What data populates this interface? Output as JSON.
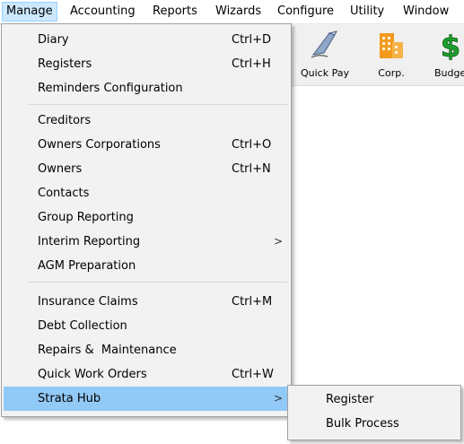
{
  "menubar": {
    "items": [
      {
        "label": "Manage"
      },
      {
        "label": "Accounting"
      },
      {
        "label": "Reports"
      },
      {
        "label": "Wizards"
      },
      {
        "label": "Configure"
      },
      {
        "label": "Utility"
      },
      {
        "label": "Window"
      }
    ]
  },
  "toolbar": {
    "buttons": [
      {
        "label": "Quick Pay",
        "icon": "quill-pen-icon"
      },
      {
        "label": "Corp.",
        "icon": "building-icon"
      },
      {
        "label": "Budge",
        "icon": "dollar-icon"
      }
    ]
  },
  "manage_menu": {
    "items": [
      {
        "label": "Diary",
        "shortcut": "Ctrl+D"
      },
      {
        "label": "Registers",
        "shortcut": "Ctrl+H"
      },
      {
        "label": "Reminders Configuration",
        "shortcut": ""
      },
      {
        "label": "Creditors",
        "shortcut": ""
      },
      {
        "label": "Owners Corporations",
        "shortcut": "Ctrl+O"
      },
      {
        "label": "Owners",
        "shortcut": "Ctrl+N"
      },
      {
        "label": "Contacts",
        "shortcut": ""
      },
      {
        "label": "Group Reporting",
        "shortcut": ""
      },
      {
        "label": "Interim Reporting",
        "shortcut": "",
        "submenu_arrow": ">"
      },
      {
        "label": "AGM Preparation",
        "shortcut": ""
      },
      {
        "label": "Insurance Claims",
        "shortcut": "Ctrl+M"
      },
      {
        "label": "Debt Collection",
        "shortcut": ""
      },
      {
        "label": "Repairs &  Maintenance",
        "shortcut": ""
      },
      {
        "label": "Quick Work Orders",
        "shortcut": "Ctrl+W"
      },
      {
        "label": "Strata Hub",
        "shortcut": "",
        "submenu_arrow": ">"
      }
    ]
  },
  "strata_hub_submenu": {
    "items": [
      {
        "label": "Register"
      },
      {
        "label": "Bulk Process"
      }
    ]
  },
  "colors": {
    "menubar_active_bg": "#cce8ff",
    "menu_bg": "#f2f2f2",
    "highlight_bg": "#91c9f7",
    "corp_icon_orange": "#f39a1e",
    "budget_icon_green": "#1e9e2e"
  }
}
